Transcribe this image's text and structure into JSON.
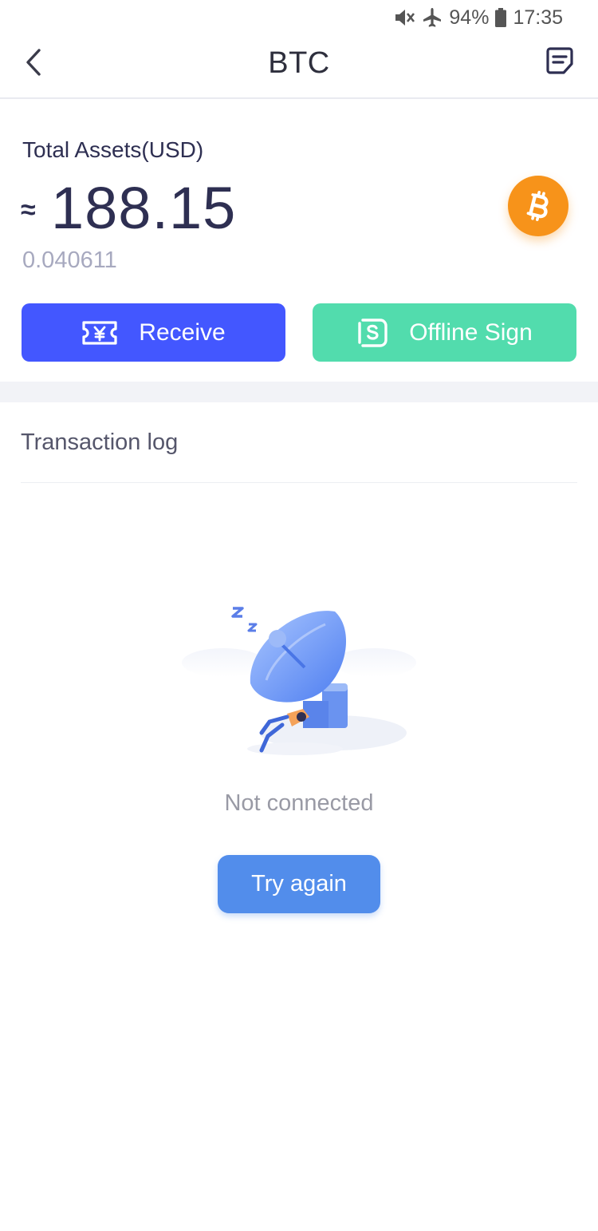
{
  "status_bar": {
    "battery": "94%",
    "time": "17:35",
    "icons": [
      "mute-icon",
      "airplane-icon",
      "battery-icon"
    ]
  },
  "nav": {
    "title": "BTC",
    "back_icon": "chevron-left-icon",
    "log_icon": "document-lines-icon"
  },
  "assets": {
    "label": "Total Assets(USD)",
    "approx": "≈",
    "usd_value": "188.15",
    "btc_value": "0.040611",
    "coin_icon": "bitcoin-icon"
  },
  "actions": {
    "receive_label": "Receive",
    "offline_sign_label": "Offline Sign"
  },
  "transactions": {
    "title": "Transaction log",
    "empty_text": "Not connected",
    "retry_label": "Try again"
  },
  "colors": {
    "receive": "#4357ff",
    "offline_sign": "#52dcad",
    "retry": "#528deb",
    "coin": "#f7931a"
  }
}
